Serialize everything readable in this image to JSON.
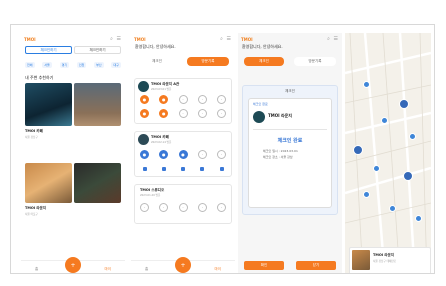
{
  "brand": "TMOI",
  "status_icons": "⌕ ☰",
  "screen1": {
    "tabs": [
      "체크인하기",
      "체크인하기"
    ],
    "chips": [
      "전체",
      "서울",
      "경기",
      "인천",
      "부산",
      "대구"
    ],
    "section_title": "내 주변 추천하기",
    "items": [
      {
        "title": "TMOI 카페",
        "sub": "서울 강남구"
      },
      {
        "title": "TMOI 라운지",
        "sub": "서울 마포구"
      }
    ],
    "nav": {
      "left": "홈",
      "right": "마이"
    },
    "fab_icon": "+"
  },
  "screen2": {
    "greeting": "환영합니다, 안녕하세요.",
    "seg_left": "체크인",
    "seg_right": "방문기록",
    "cards": [
      {
        "title": "TMOI 라운지 A관",
        "sub": "2023.03.01 방문"
      },
      {
        "title": "TMOI 카페",
        "sub": "2023.02.14 방문"
      },
      {
        "title": "TMOI 스튜디오",
        "sub": "2023.01.20 방문"
      }
    ],
    "nav": {
      "left": "홈",
      "right": "마이"
    },
    "fab_icon": "+"
  },
  "screen3": {
    "greeting": "환영합니다, 안녕하세요.",
    "seg_left": "체크인",
    "seg_right": "방문기록",
    "modal_head": "체크인",
    "modal_label": "체크인 완료",
    "modal_venue": "TMOI 라운지",
    "modal_code": "체크인 완료",
    "modal_lines": [
      "체크인 일시 : 2023.03.01",
      "체크인 장소 : 서울 강남"
    ],
    "nav": {
      "left": "확인",
      "right": "닫기"
    }
  },
  "screen4": {
    "place_title": "TMOI 라운지",
    "place_sub": "서울 강남구 테헤란로"
  },
  "colors": {
    "accent": "#f57a20",
    "blue": "#3a78d6"
  }
}
